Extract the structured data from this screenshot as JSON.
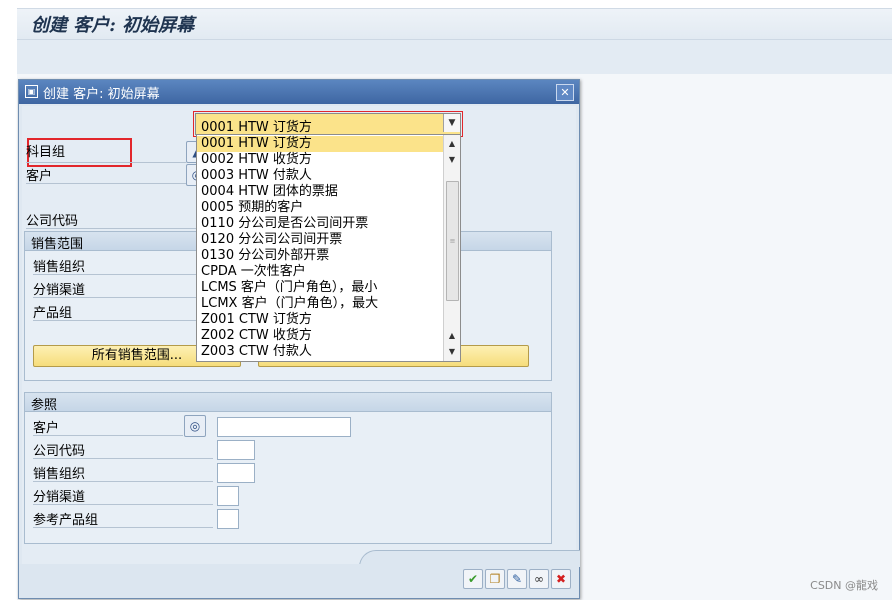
{
  "window": {
    "title": "创建 客户: 初始屏幕"
  },
  "dialog": {
    "title": "创建 客户: 初始屏幕",
    "fields": {
      "account_group_label": "科目组",
      "customer_label": "客户",
      "company_code_label": "公司代码"
    },
    "account_group_value": "0001 HTW 订货方",
    "dropdown_options": [
      "0001 HTW 订货方",
      "0002 HTW 收货方",
      "0003 HTW 付款人",
      "0004 HTW 团体的票据",
      "0005 预期的客户",
      "0110 分公司是否公司间开票",
      "0120 分公司公司间开票",
      "0130 分公司外部开票",
      "CPDA 一次性客户",
      "LCMS 客户（门户角色），最小",
      "LCMX 客户（门户角色），最大",
      "Z001 CTW 订货方",
      "Z002 CTW 收货方",
      "Z003 CTW 付款人"
    ],
    "sales_area": {
      "header": "销售范围",
      "sales_org_label": "销售组织",
      "distribution_channel_label": "分销渠道",
      "division_label": "产品组",
      "all_sales_areas_button": "所有销售范围..."
    },
    "reference": {
      "header": "参照",
      "customer_label": "客户",
      "company_code_label": "公司代码",
      "sales_org_label": "销售组织",
      "distribution_channel_label": "分销渠道",
      "ref_division_label": "参考产品组"
    }
  },
  "icons": {
    "dialog_title": "window-icon",
    "close": "close-icon",
    "matchcode": "binoculars-icon",
    "account_group_help": "mountain-icon",
    "confirm": "check-icon",
    "copy": "copy-icon",
    "edit": "pencil-icon",
    "glasses": "glasses-icon",
    "cancel": "cancel-icon"
  },
  "colors": {
    "highlight": "#e2262b",
    "selected": "#fbe38a",
    "title_bar": "#3e66a2"
  },
  "watermark": "CSDN @龍戏"
}
